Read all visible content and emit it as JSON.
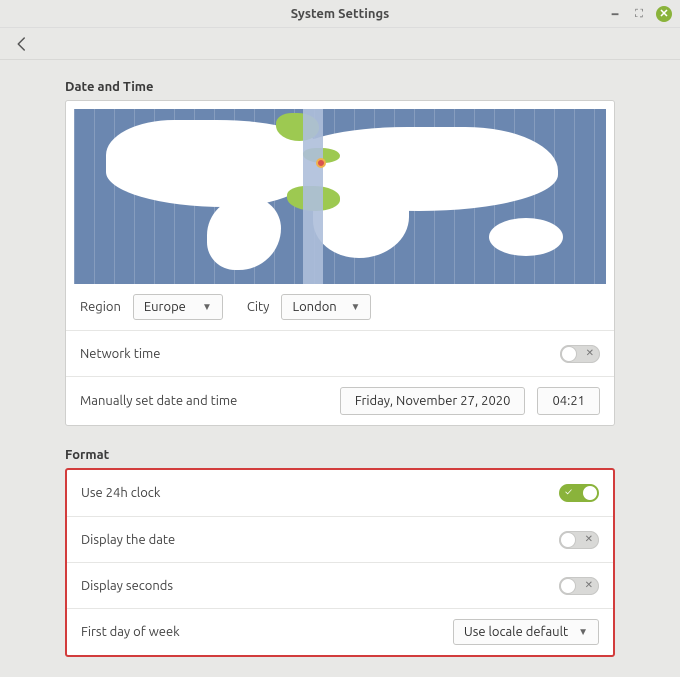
{
  "window": {
    "title": "System Settings"
  },
  "sections": {
    "datetime": {
      "title": "Date and Time",
      "region_label": "Region",
      "region_value": "Europe",
      "city_label": "City",
      "city_value": "London",
      "network_time_label": "Network time",
      "network_time_on": false,
      "manual_label": "Manually set date and time",
      "date_value": "Friday, November 27, 2020",
      "time_value": "04:21"
    },
    "format": {
      "title": "Format",
      "use_24h_label": "Use 24h clock",
      "use_24h_on": true,
      "display_date_label": "Display the date",
      "display_date_on": false,
      "display_seconds_label": "Display seconds",
      "display_seconds_on": false,
      "first_day_label": "First day of week",
      "first_day_value": "Use locale default"
    }
  }
}
